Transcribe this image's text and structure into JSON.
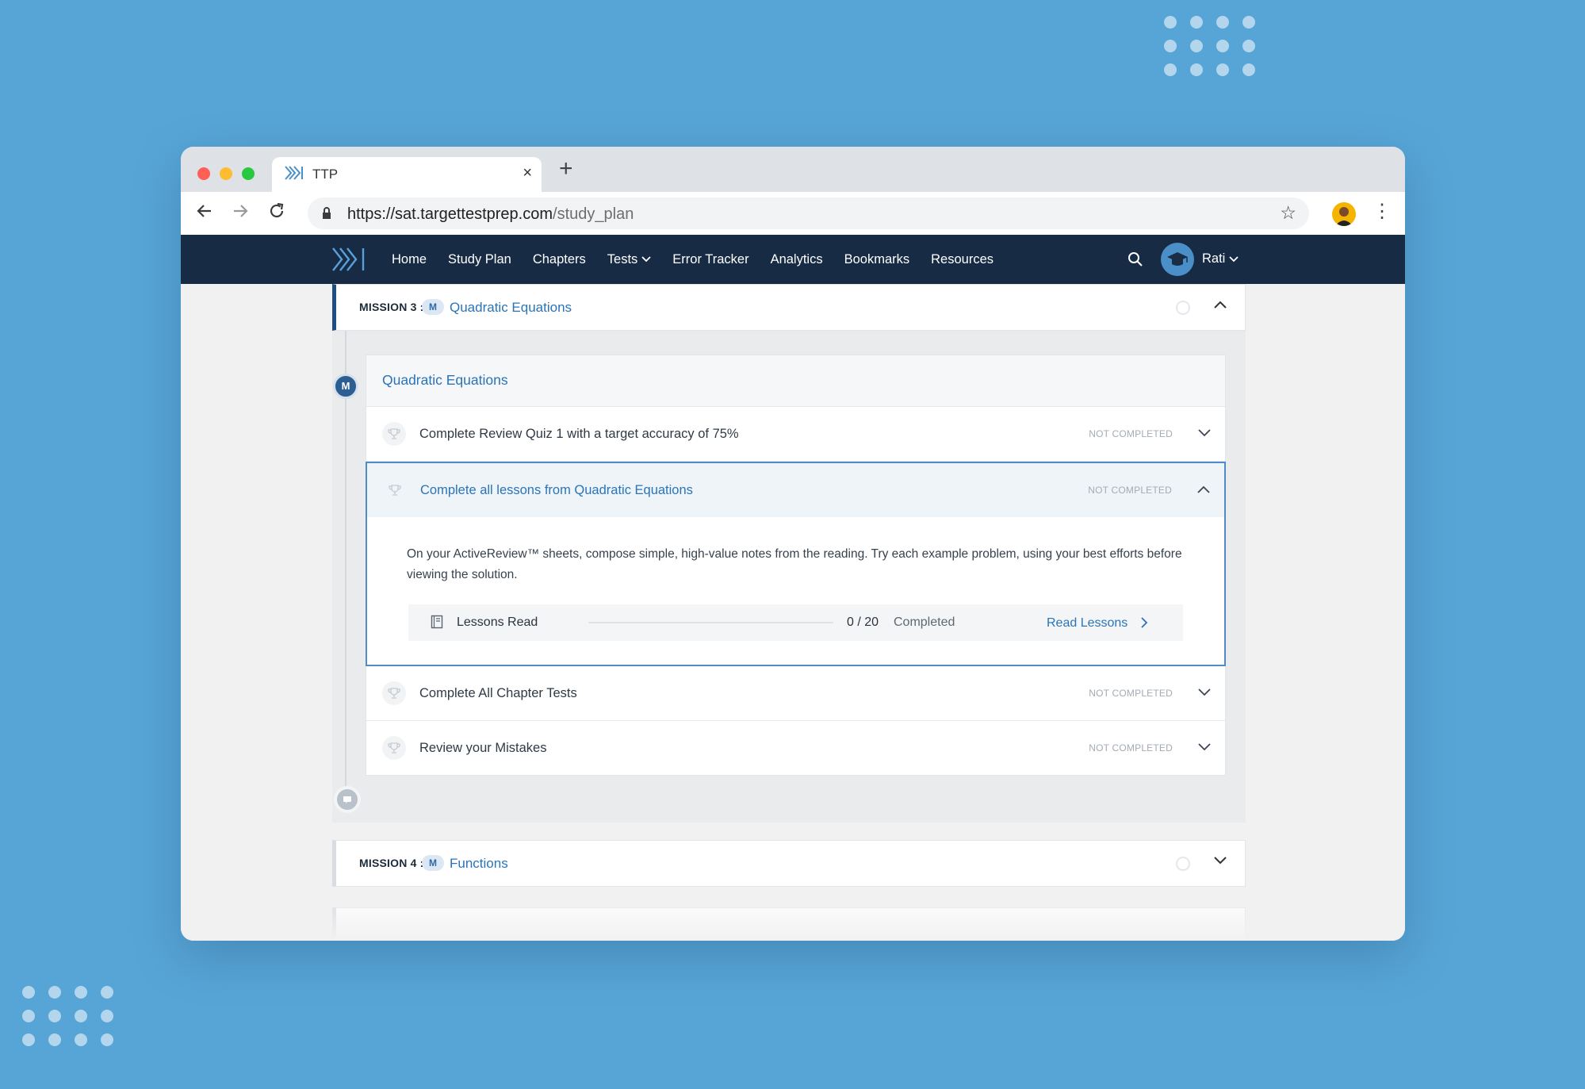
{
  "browser": {
    "tab_title": "TTP",
    "tab_close": "×",
    "new_tab": "+",
    "url_host": "https://sat.targettestprep.com",
    "url_path": "/study_plan"
  },
  "site_nav": {
    "links": [
      "Home",
      "Study Plan",
      "Chapters",
      "Tests",
      "Error Tracker",
      "Analytics",
      "Bookmarks",
      "Resources"
    ],
    "user_name": "Rati"
  },
  "mission3": {
    "label": "MISSION 3 :",
    "badge": "M",
    "title": "Quadratic Equations",
    "chapter": {
      "title": "Quadratic Equations",
      "tasks": [
        {
          "text": "Complete Review Quiz 1 with a target accuracy of 75%",
          "status": "NOT COMPLETED"
        },
        {
          "text": "Complete all lessons from Quadratic Equations",
          "status": "NOT COMPLETED"
        },
        {
          "text": "Complete All Chapter Tests",
          "status": "NOT COMPLETED"
        },
        {
          "text": "Review your Mistakes",
          "status": "NOT COMPLETED"
        }
      ],
      "expanded": {
        "description": "On your ActiveReview™ sheets, compose simple, high-value notes from the reading. Try each example problem, using your best efforts before viewing the solution.",
        "progress_label": "Lessons Read",
        "progress_count": "0 / 20",
        "progress_fraction": 0,
        "progress_state": "Completed",
        "action": "Read Lessons"
      }
    }
  },
  "mission4": {
    "label": "MISSION 4 :",
    "badge": "M",
    "title": "Functions"
  },
  "colors": {
    "background": "#57a5d6",
    "nav_bg": "#172b45",
    "accent": "#2a74b8"
  }
}
